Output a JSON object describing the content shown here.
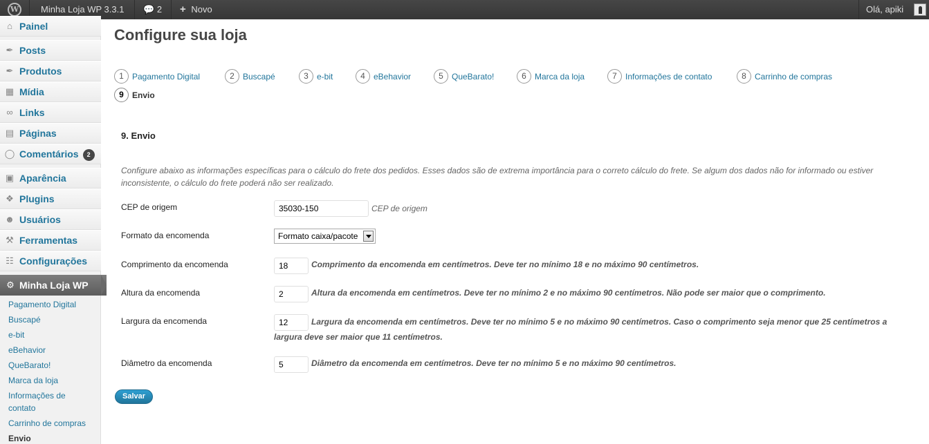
{
  "adminbar": {
    "site_name": "Minha Loja WP 3.3.1",
    "comments_count": "2",
    "new_label": "Novo",
    "greeting": "Olá, apiki"
  },
  "sidebar": {
    "items": [
      {
        "label": "Painel",
        "icon": "dashboard-icon"
      },
      {
        "label": "Posts",
        "icon": "pin-icon"
      },
      {
        "label": "Produtos",
        "icon": "pin-icon"
      },
      {
        "label": "Mídia",
        "icon": "media-icon"
      },
      {
        "label": "Links",
        "icon": "link-icon"
      },
      {
        "label": "Páginas",
        "icon": "pages-icon"
      },
      {
        "label": "Comentários",
        "icon": "comment-icon",
        "badge": "2"
      },
      {
        "label": "Aparência",
        "icon": "appearance-icon"
      },
      {
        "label": "Plugins",
        "icon": "plugin-icon"
      },
      {
        "label": "Usuários",
        "icon": "users-icon"
      },
      {
        "label": "Ferramentas",
        "icon": "tools-icon"
      },
      {
        "label": "Configurações",
        "icon": "settings-icon"
      }
    ],
    "current": {
      "label": "Minha Loja WP",
      "icon": "gear-icon"
    },
    "submenu": [
      "Pagamento Digital",
      "Buscapé",
      "e-bit",
      "eBehavior",
      "QueBarato!",
      "Marca da loja",
      "Informações de contato",
      "Carrinho de compras",
      "Envio"
    ]
  },
  "main": {
    "title": "Configure sua loja",
    "steps": [
      {
        "num": "1",
        "label": "Pagamento Digital"
      },
      {
        "num": "2",
        "label": "Buscapé"
      },
      {
        "num": "3",
        "label": "e-bit"
      },
      {
        "num": "4",
        "label": "eBehavior"
      },
      {
        "num": "5",
        "label": "QueBarato!"
      },
      {
        "num": "6",
        "label": "Marca da loja"
      },
      {
        "num": "7",
        "label": "Informações de contato"
      },
      {
        "num": "8",
        "label": "Carrinho de compras"
      },
      {
        "num": "9",
        "label": "Envio"
      }
    ],
    "section_title": "9. Envio",
    "description": "Configure abaixo as informações específicas para o cálculo do frete dos pedidos. Esses dados são de extrema importância para o correto cálculo do frete. Se algum dos dados não for informado ou estiver inconsistente, o cálculo do frete poderá não ser realizado.",
    "fields": {
      "cep": {
        "label": "CEP de origem",
        "value": "35030-150",
        "note": "CEP de origem"
      },
      "formato": {
        "label": "Formato da encomenda",
        "value": "Formato caixa/pacote"
      },
      "comprimento": {
        "label": "Comprimento da encomenda",
        "value": "18",
        "desc": "Comprimento da encomenda em centímetros. Deve ter no mínimo 18 e no máximo 90 centímetros."
      },
      "altura": {
        "label": "Altura da encomenda",
        "value": "2",
        "desc": "Altura da encomenda em centímetros. Deve ter no mínimo 2 e no máximo 90 centímetros. Não pode ser maior que o comprimento."
      },
      "largura": {
        "label": "Largura da encomenda",
        "value": "12",
        "desc_line1": "Largura da encomenda em centímetros. Deve ter no mínimo 5 e no máximo 90 centímetros. Caso o comprimento seja menor que 25 centímetros a",
        "desc_line2": "largura deve ser maior que 11 centímetros."
      },
      "diametro": {
        "label": "Diâmetro da encomenda",
        "value": "5",
        "desc": "Diâmetro da encomenda em centímetros. Deve ter no mínimo 5 e no máximo 90 centímetros."
      }
    },
    "save_label": "Salvar"
  }
}
